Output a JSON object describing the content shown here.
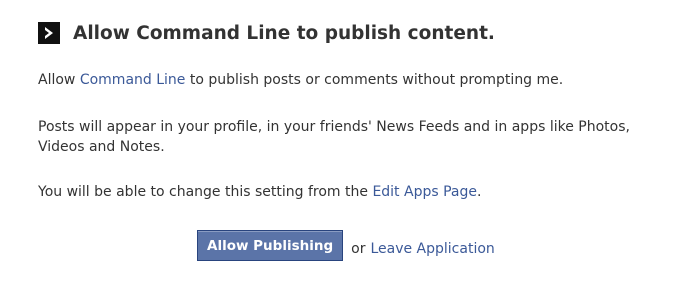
{
  "dialog": {
    "title": "Allow Command Line to publish content.",
    "icon": "app-chevron-icon",
    "paragraph1": {
      "prefix": "Allow ",
      "app_link": "Command Line",
      "suffix": " to publish posts or comments without prompting me."
    },
    "paragraph2": "Posts will appear in your profile, in your friends' News Feeds and in apps like Photos, Videos and Notes.",
    "paragraph3": {
      "prefix": "You will be able to change this setting from the ",
      "link": "Edit Apps Page",
      "suffix": "."
    },
    "actions": {
      "allow_button": "Allow Publishing",
      "or_text": "or",
      "leave_link": "Leave Application"
    }
  },
  "colors": {
    "link": "#3b5998",
    "button_bg": "#5b74a8",
    "button_border": "#29447e",
    "text": "#333333"
  }
}
